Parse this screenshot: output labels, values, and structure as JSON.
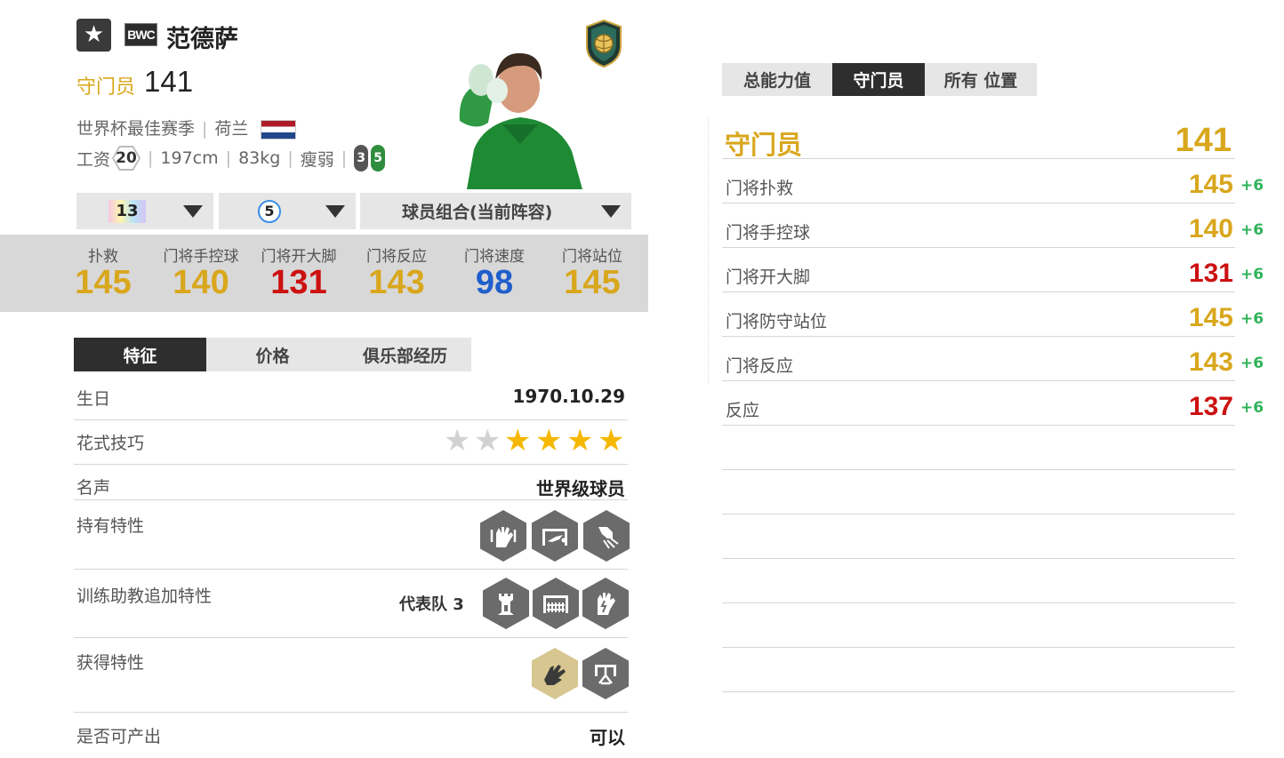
{
  "player": {
    "name": "范德萨",
    "season_badge": "BWC",
    "position": "守门员",
    "ovr": "141",
    "season": "世界杯最佳赛季",
    "nation": "荷兰",
    "wage_label": "工资",
    "wage": "20",
    "height": "197cm",
    "weight": "83kg",
    "body": "瘦弱",
    "foot_left": "3",
    "foot_right": "5"
  },
  "selectors": {
    "upgrade": "13",
    "level": "5",
    "combo": "球员组合(当前阵容)"
  },
  "stats": [
    {
      "label": "扑救",
      "value": "145",
      "color": "#d9a71d"
    },
    {
      "label": "门将手控球",
      "value": "140",
      "color": "#d9a71d"
    },
    {
      "label": "门将开大脚",
      "value": "131",
      "color": "#cc1111"
    },
    {
      "label": "门将反应",
      "value": "143",
      "color": "#d9a71d"
    },
    {
      "label": "门将速度",
      "value": "98",
      "color": "#1f5fcc"
    },
    {
      "label": "门将站位",
      "value": "145",
      "color": "#d9a71d"
    }
  ],
  "tabs": [
    "特征",
    "价格",
    "俱乐部经历"
  ],
  "details": {
    "birthday_label": "生日",
    "birthday": "1970.10.29",
    "skill_label": "花式技巧",
    "skill_stars": 4,
    "fame_label": "名声",
    "fame": "世界级球员",
    "traits_label": "持有特性",
    "coach_label": "训练助教追加特性",
    "coach_value": "代表队 3",
    "acquired_label": "获得特性",
    "produce_label": "是否可产出",
    "produce": "可以"
  },
  "right": {
    "tabs": [
      "总能力值",
      "守门员",
      "所有 位置"
    ],
    "position": "守门员",
    "position_ovr": "141",
    "attrs": [
      {
        "label": "门将扑救",
        "value": "145",
        "bonus": "+6",
        "color": "#d9a71d"
      },
      {
        "label": "门将手控球",
        "value": "140",
        "bonus": "+6",
        "color": "#d9a71d"
      },
      {
        "label": "门将开大脚",
        "value": "131",
        "bonus": "+6",
        "color": "#cc1111"
      },
      {
        "label": "门将防守站位",
        "value": "145",
        "bonus": "+6",
        "color": "#d9a71d"
      },
      {
        "label": "门将反应",
        "value": "143",
        "bonus": "+6",
        "color": "#d9a71d"
      },
      {
        "label": "反应",
        "value": "137",
        "bonus": "+6",
        "color": "#cc1111"
      }
    ]
  },
  "icons": [
    "star-icon",
    "club-crest-icon",
    "dropdown-arrow-icon",
    "trait-gloves-icon"
  ]
}
